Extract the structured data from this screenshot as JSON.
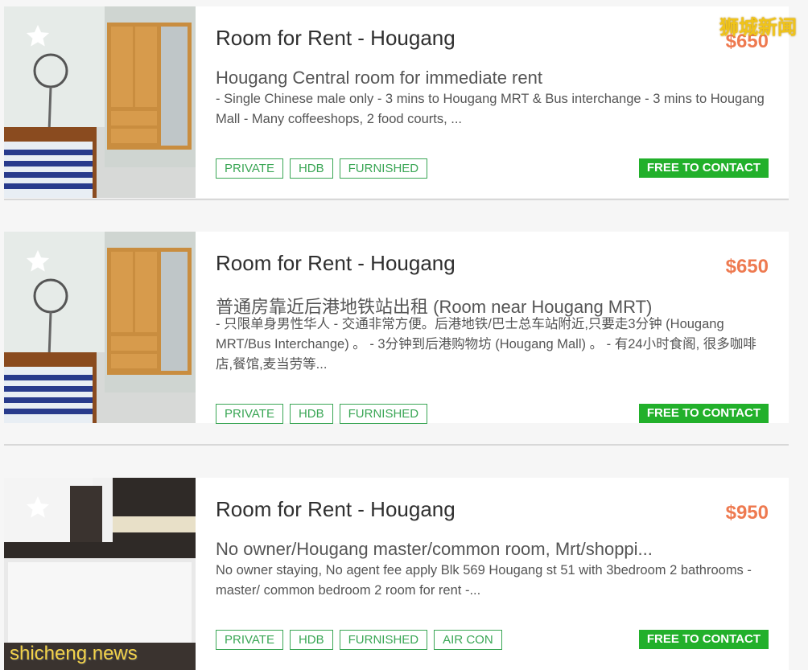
{
  "listings": [
    {
      "title": "Room for Rent - Hougang",
      "price": "$650",
      "subtitle": "Hougang Central room for immediate rent",
      "description": "- Single Chinese male only - 3 mins to Hougang MRT & Bus interchange - 3 mins to Hougang Mall - Many coffeeshops, 2 food courts, ...",
      "tags": [
        "PRIVATE",
        "HDB",
        "FURNISHED"
      ],
      "contact_label": "FREE TO CONTACT"
    },
    {
      "title": "Room for Rent - Hougang",
      "price": "$650",
      "subtitle": "普通房靠近后港地铁站出租 (Room near Hougang MRT)",
      "description": "- 只限单身男性华人 - 交通非常方便。后港地铁/巴士总车站附近,只要走3分钟 (Hougang MRT/Bus Interchange) 。 - 3分钟到后港购物坊 (Hougang Mall) 。 - 有24小时食阁, 很多咖啡店,餐馆,麦当劳等...",
      "tags": [
        "PRIVATE",
        "HDB",
        "FURNISHED"
      ],
      "contact_label": "FREE TO CONTACT"
    },
    {
      "title": "Room for Rent - Hougang",
      "price": "$950",
      "subtitle": "No owner/Hougang master/common room, Mrt/shoppi...",
      "description": "No owner staying, No agent fee apply Blk 569 Hougang st 51 with 3bedroom 2 bathrooms - master/ common bedroom 2 room for rent -...",
      "tags": [
        "PRIVATE",
        "HDB",
        "FURNISHED",
        "AIR CON"
      ],
      "contact_label": "FREE TO CONTACT"
    }
  ],
  "watermarks": {
    "top_right": "狮城新闻",
    "bottom_left": "shicheng.news"
  },
  "colors": {
    "price": "#ee7a50",
    "tag_green": "#3aa655",
    "contact_button": "#22b02b",
    "favorite_star": "#ffffff"
  },
  "icons": {
    "favorite": "star-icon"
  }
}
